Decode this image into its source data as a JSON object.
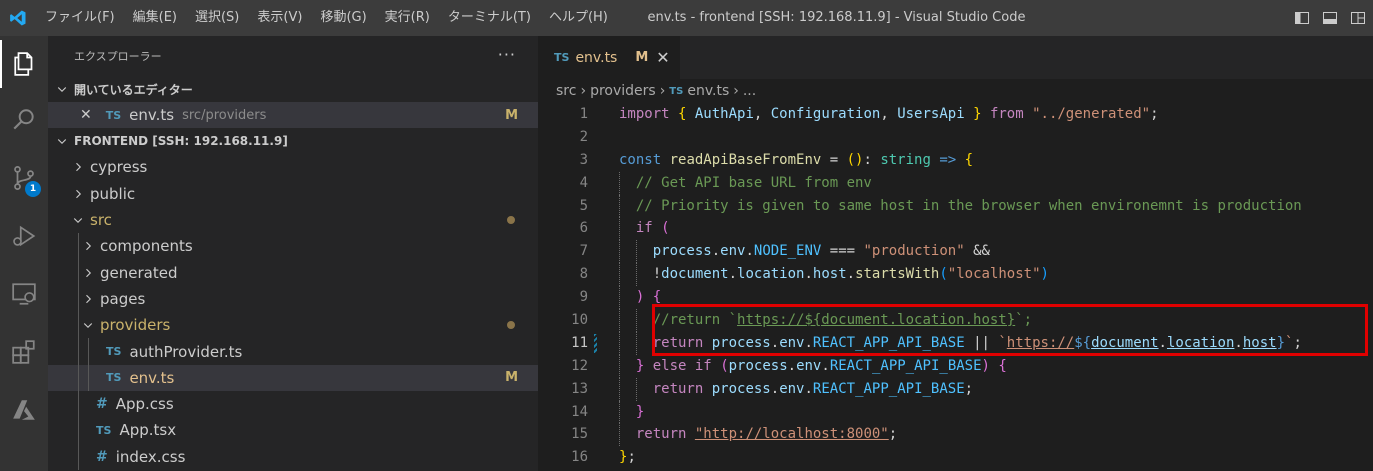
{
  "menu": [
    "ファイル(F)",
    "編集(E)",
    "選択(S)",
    "表示(V)",
    "移動(G)",
    "実行(R)",
    "ターミナル(T)",
    "ヘルプ(H)"
  ],
  "window_title": "env.ts - frontend [SSH: 192.168.11.9] - Visual Studio Code",
  "activity": {
    "scm_badge": "1"
  },
  "sidebar": {
    "title": "エクスプローラー",
    "more": "···",
    "open_editors_label": "開いているエディター",
    "open_editor": {
      "icon": "TS",
      "name": "env.ts",
      "path": "src/providers",
      "status": "M"
    },
    "folder_label": "FRONTEND [SSH: 192.168.11.9]",
    "tree": [
      {
        "name": "cypress",
        "kind": "folder",
        "depth": 0
      },
      {
        "name": "public",
        "kind": "folder",
        "depth": 0
      },
      {
        "name": "src",
        "kind": "folder-open",
        "depth": 0,
        "dot": true
      },
      {
        "name": "components",
        "kind": "folder",
        "depth": 1
      },
      {
        "name": "generated",
        "kind": "folder",
        "depth": 1
      },
      {
        "name": "pages",
        "kind": "folder",
        "depth": 1
      },
      {
        "name": "providers",
        "kind": "folder-open",
        "depth": 1,
        "dot": true
      },
      {
        "name": "authProvider.ts",
        "kind": "ts",
        "depth": 2
      },
      {
        "name": "env.ts",
        "kind": "ts",
        "depth": 2,
        "selected": true,
        "status": "M"
      },
      {
        "name": "App.css",
        "kind": "css",
        "depth": 1
      },
      {
        "name": "App.tsx",
        "kind": "ts",
        "depth": 1
      },
      {
        "name": "index.css",
        "kind": "css",
        "depth": 1
      }
    ]
  },
  "editor": {
    "tab": {
      "icon": "TS",
      "name": "env.ts",
      "status": "M",
      "close": "✕"
    },
    "breadcrumb": [
      "src",
      "providers",
      "env.ts",
      "..."
    ],
    "lines": [
      {
        "n": "1",
        "tokens": [
          [
            "kw",
            "import"
          ],
          [
            "pl",
            " "
          ],
          [
            "br1",
            "{"
          ],
          [
            "vr",
            " AuthApi"
          ],
          [
            "pl",
            ", "
          ],
          [
            "vr",
            "Configuration"
          ],
          [
            "pl",
            ", "
          ],
          [
            "vr",
            "UsersApi"
          ],
          [
            "pl",
            " "
          ],
          [
            "br1",
            "}"
          ],
          [
            "pl",
            " "
          ],
          [
            "kw",
            "from"
          ],
          [
            "pl",
            " "
          ],
          [
            "st",
            "\"../generated\""
          ],
          [
            "pl",
            ";"
          ]
        ]
      },
      {
        "n": "2",
        "tokens": []
      },
      {
        "n": "3",
        "tokens": [
          [
            "kb",
            "const"
          ],
          [
            "pl",
            " "
          ],
          [
            "fn",
            "readApiBaseFromEnv"
          ],
          [
            "pl",
            " = "
          ],
          [
            "br1",
            "()"
          ],
          [
            "pl",
            ": "
          ],
          [
            "ty",
            "string"
          ],
          [
            "pl",
            " "
          ],
          [
            "kb",
            "=>"
          ],
          [
            "pl",
            " "
          ],
          [
            "br1",
            "{"
          ]
        ]
      },
      {
        "n": "4",
        "indent": 1,
        "tokens": [
          [
            "cm",
            "// Get API base URL from env"
          ]
        ]
      },
      {
        "n": "5",
        "indent": 1,
        "tokens": [
          [
            "cm",
            "// Priority is given to same host in the browser when environemnt is production"
          ]
        ]
      },
      {
        "n": "6",
        "indent": 1,
        "tokens": [
          [
            "kw",
            "if"
          ],
          [
            "pl",
            " "
          ],
          [
            "br2",
            "("
          ]
        ]
      },
      {
        "n": "7",
        "indent": 2,
        "tokens": [
          [
            "vr",
            "process"
          ],
          [
            "pl",
            "."
          ],
          [
            "vr",
            "env"
          ],
          [
            "pl",
            "."
          ],
          [
            "cn",
            "NODE_ENV"
          ],
          [
            "pl",
            " === "
          ],
          [
            "st",
            "\"production\""
          ],
          [
            "pl",
            " &&"
          ]
        ]
      },
      {
        "n": "8",
        "indent": 2,
        "tokens": [
          [
            "pl",
            "!"
          ],
          [
            "vr",
            "document"
          ],
          [
            "pl",
            "."
          ],
          [
            "vr",
            "location"
          ],
          [
            "pl",
            "."
          ],
          [
            "vr",
            "host"
          ],
          [
            "pl",
            "."
          ],
          [
            "fn",
            "startsWith"
          ],
          [
            "br3",
            "("
          ],
          [
            "st",
            "\"localhost\""
          ],
          [
            "br3",
            ")"
          ]
        ]
      },
      {
        "n": "9",
        "indent": 1,
        "tokens": [
          [
            "br2",
            ")"
          ],
          [
            "pl",
            " "
          ],
          [
            "br2",
            "{"
          ]
        ]
      },
      {
        "n": "10",
        "indent": 2,
        "tokens": [
          [
            "cm",
            "//return `"
          ],
          [
            "cm_ul",
            "https://${document.location.host}"
          ],
          [
            "cm",
            "`;"
          ]
        ]
      },
      {
        "n": "11",
        "indent": 2,
        "dirty": true,
        "tokens": [
          [
            "kw",
            "return"
          ],
          [
            "pl",
            " "
          ],
          [
            "vr",
            "process"
          ],
          [
            "pl",
            "."
          ],
          [
            "vr",
            "env"
          ],
          [
            "pl",
            "."
          ],
          [
            "cn",
            "REACT_APP_API_BASE"
          ],
          [
            "pl",
            " || "
          ],
          [
            "st",
            "`"
          ],
          [
            "st_ul",
            "https://"
          ],
          [
            "kb",
            "${"
          ],
          [
            "vr_ul",
            "document"
          ],
          [
            "pl",
            "."
          ],
          [
            "vr_ul",
            "location"
          ],
          [
            "pl",
            "."
          ],
          [
            "vr_ul",
            "host"
          ],
          [
            "kb",
            "}"
          ],
          [
            "st",
            "`"
          ],
          [
            "pl",
            ";"
          ]
        ]
      },
      {
        "n": "12",
        "indent": 1,
        "tokens": [
          [
            "br2",
            "}"
          ],
          [
            "pl",
            " "
          ],
          [
            "kw",
            "else if"
          ],
          [
            "pl",
            " "
          ],
          [
            "br2",
            "("
          ],
          [
            "vr",
            "process"
          ],
          [
            "pl",
            "."
          ],
          [
            "vr",
            "env"
          ],
          [
            "pl",
            "."
          ],
          [
            "cn",
            "REACT_APP_API_BASE"
          ],
          [
            "br2",
            ")"
          ],
          [
            "pl",
            " "
          ],
          [
            "br2",
            "{"
          ]
        ]
      },
      {
        "n": "13",
        "indent": 2,
        "tokens": [
          [
            "kw",
            "return"
          ],
          [
            "pl",
            " "
          ],
          [
            "vr",
            "process"
          ],
          [
            "pl",
            "."
          ],
          [
            "vr",
            "env"
          ],
          [
            "pl",
            "."
          ],
          [
            "cn",
            "REACT_APP_API_BASE"
          ],
          [
            "pl",
            ";"
          ]
        ]
      },
      {
        "n": "14",
        "indent": 1,
        "tokens": [
          [
            "br2",
            "}"
          ]
        ]
      },
      {
        "n": "15",
        "indent": 1,
        "tokens": [
          [
            "kw",
            "return"
          ],
          [
            "pl",
            " "
          ],
          [
            "st_ul",
            "\"http://localhost:8000\""
          ],
          [
            "pl",
            ";"
          ]
        ]
      },
      {
        "n": "16",
        "tokens": [
          [
            "br1",
            "}"
          ],
          [
            "pl",
            ";"
          ]
        ]
      }
    ]
  }
}
